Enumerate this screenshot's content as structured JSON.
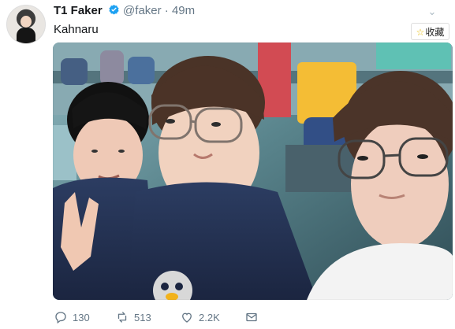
{
  "tweet": {
    "display_name": "T1 Faker",
    "handle": "@faker",
    "separator": "·",
    "time": "49m",
    "text": "Kahnaru"
  },
  "save_badge": {
    "label": "收藏",
    "icon": "star-icon"
  },
  "actions": {
    "replies": "130",
    "retweets": "513",
    "likes": "2.2K"
  },
  "icons": {
    "verified": "verified-badge-icon",
    "menu": "chevron-down-icon",
    "reply": "reply-icon",
    "retweet": "retweet-icon",
    "like": "heart-icon",
    "message": "mail-icon"
  },
  "colors": {
    "verified": "#1da1f2",
    "text_primary": "#14171a",
    "text_secondary": "#657786",
    "icon_muted": "#aab8c2"
  }
}
